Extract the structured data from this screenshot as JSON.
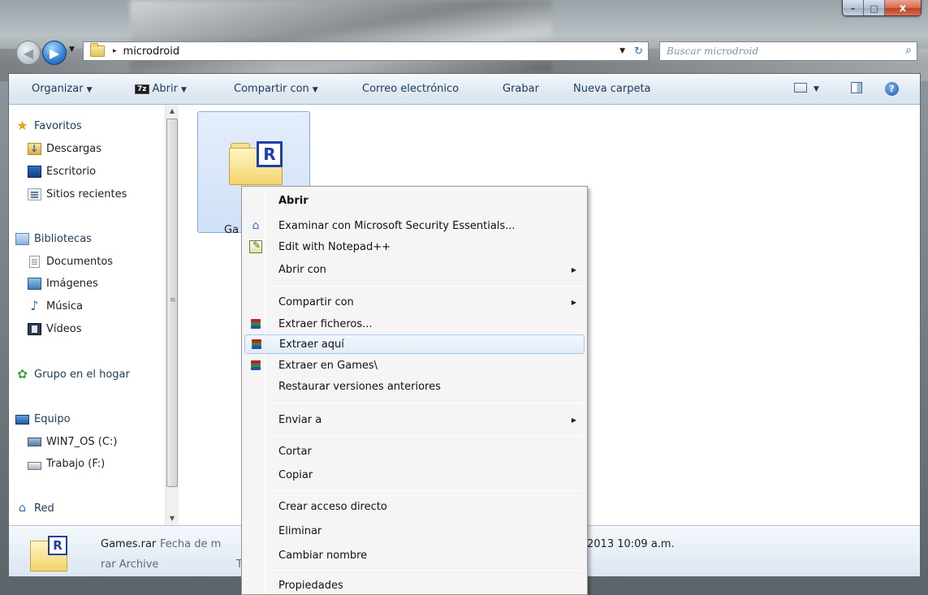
{
  "window": {
    "caption": {
      "minimize": "–",
      "maximize": "□",
      "close": "x"
    }
  },
  "address_bar": {
    "back": "◀",
    "forward": "▶",
    "history": "▼",
    "separator": "▸",
    "path": "microdroid",
    "dropdown": "▼",
    "refresh": "↻"
  },
  "search": {
    "placeholder": "Buscar microdroid",
    "icon": "search-icon"
  },
  "toolbar": {
    "organize": "Organizar",
    "sevenzip_badge": "7z",
    "open": "Abrir",
    "share": "Compartir con",
    "email": "Correo electrónico",
    "burn": "Grabar",
    "new_folder": "Nueva carpeta",
    "dd": "▼",
    "help": "?"
  },
  "navpane": {
    "favorites": "Favoritos",
    "downloads": "Descargas",
    "desktop": "Escritorio",
    "recent": "Sitios recientes",
    "libraries": "Bibliotecas",
    "documents": "Documentos",
    "pictures": "Imágenes",
    "music": "Música",
    "videos": "Vídeos",
    "homegroup": "Grupo en el hogar",
    "computer": "Equipo",
    "drive_c": "WIN7_OS (C:)",
    "drive_f": "Trabajo (F:)",
    "network": "Red"
  },
  "scrollbar": {
    "up": "▲",
    "down": "▼",
    "grip": "≡"
  },
  "content": {
    "file_tile_name": "Ga",
    "rar_badge": "R"
  },
  "details": {
    "name": "Games.rar",
    "date_label": "Fecha de m",
    "type": "rar Archive",
    "t_label": "T",
    "date_value": "2013 10:09 a.m.",
    "rar_badge": "R"
  },
  "context_menu": {
    "items": [
      {
        "label": "Abrir"
      },
      {
        "label": "Examinar con Microsoft Security Essentials..."
      },
      {
        "label": "Edit with Notepad++"
      },
      {
        "label": "Abrir con"
      },
      {
        "label": "Compartir con"
      },
      {
        "label": "Extraer ficheros..."
      },
      {
        "label": "Extraer aquí"
      },
      {
        "label": "Extraer en Games\\"
      },
      {
        "label": "Restaurar versiones anteriores"
      },
      {
        "label": "Enviar a"
      },
      {
        "label": "Cortar"
      },
      {
        "label": "Copiar"
      },
      {
        "label": "Crear acceso directo"
      },
      {
        "label": "Eliminar"
      },
      {
        "label": "Cambiar nombre"
      },
      {
        "label": "Propiedades"
      }
    ],
    "submenu_arrow": "▶"
  },
  "colors": {
    "highlight_border": "#a8c8ec",
    "winrar_red": "#b8232a",
    "winrar_green": "#2d8a3a",
    "winrar_blue": "#2a4fa8",
    "rar_badge": "#1f3ea8"
  }
}
